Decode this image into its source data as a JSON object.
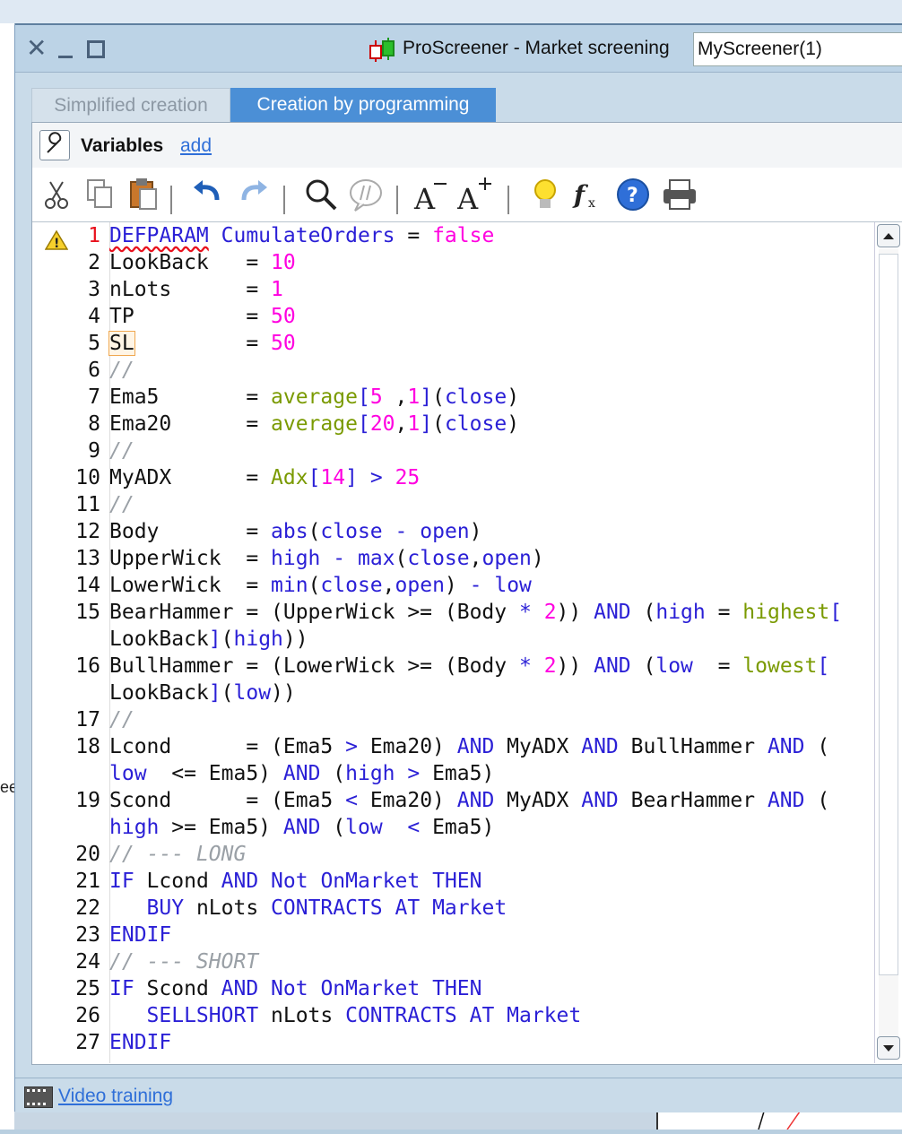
{
  "window": {
    "title": "ProScreener - Market screening",
    "screener_name": "MyScreener(1)"
  },
  "tabs": [
    {
      "label": "Simplified creation",
      "active": false
    },
    {
      "label": "Creation by programming",
      "active": true
    }
  ],
  "variables": {
    "label": "Variables",
    "add_link": "add"
  },
  "toolbar": [
    "cut-icon",
    "copy-icon",
    "paste-icon",
    "undo-icon",
    "redo-icon",
    "search-icon",
    "comment-icon",
    "decrease-font-icon",
    "increase-font-icon",
    "lightbulb-icon",
    "function-icon",
    "help-icon",
    "print-icon"
  ],
  "editor": {
    "warning_line": 1,
    "line_numbers": [
      "1",
      "2",
      "3",
      "4",
      "5",
      "6",
      "7",
      "8",
      "9",
      "10",
      "11",
      "12",
      "13",
      "14",
      "15",
      "",
      "16",
      "",
      "17",
      "18",
      "",
      "19",
      "",
      "20",
      "21",
      "22",
      "23",
      "24",
      "25",
      "26",
      "27"
    ]
  },
  "footer": {
    "video_link": "Video training"
  },
  "background": {
    "left_fragment": "ee"
  },
  "colors": {
    "keyword": "#2a1fd6",
    "number": "#ff00e0",
    "function": "#7a9a00",
    "comment": "#9aa0a6",
    "tab_active": "#4b8fd6"
  }
}
